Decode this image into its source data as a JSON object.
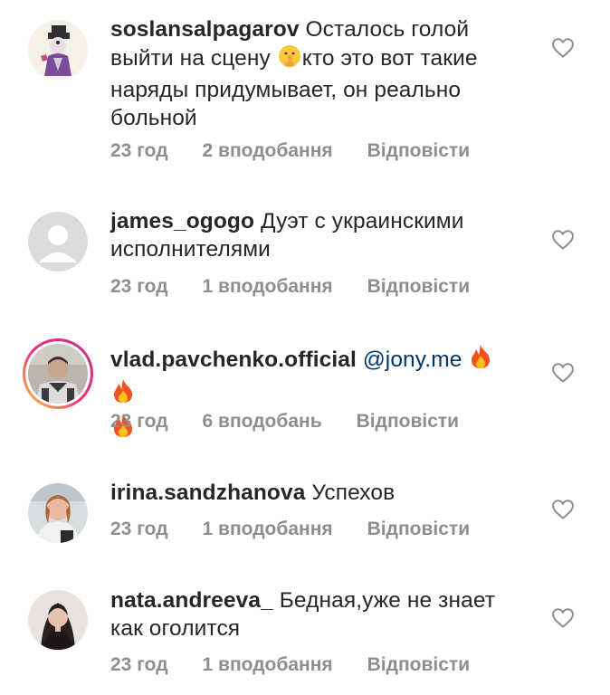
{
  "comments": [
    {
      "username": "soslansalpagarov",
      "text_before": "Осталось голой выйти на сцену ",
      "emoji": "🤫",
      "text_after": "кто это вот такие наряды придумывает, он реально больной",
      "time": "23 год",
      "likes": "2 вподобання",
      "reply": "Відповісти"
    },
    {
      "username": "james_ogogo",
      "text": "Дуэт с украинскими исполнителями",
      "time": "23 год",
      "likes": "1 вподобання",
      "reply": "Відповісти"
    },
    {
      "username": "vlad.pavchenko.official",
      "mention": "@jony.me",
      "emoji": "🔥🔥🔥",
      "time": "23 год",
      "likes": "6 вподобань",
      "reply": "Відповісти"
    },
    {
      "username": "irina.sandzhanova",
      "text": "Успехов",
      "time": "23 год",
      "likes": "1 вподобання",
      "reply": "Відповісти"
    },
    {
      "username": "nata.andreeva_",
      "text": "Бедная,уже не знает как оголится",
      "time": "23 год",
      "likes": "1 вподобання",
      "reply": "Відповісти"
    }
  ],
  "colors": {
    "text": "#262626",
    "meta": "#8e8e8e",
    "mention": "#00376b",
    "story_ring_start": "#f9ce34",
    "story_ring_end": "#c13584"
  },
  "icons": {
    "like": "heart-outline-icon",
    "fire": "fire-emoji",
    "shush": "shushing-face-emoji"
  }
}
